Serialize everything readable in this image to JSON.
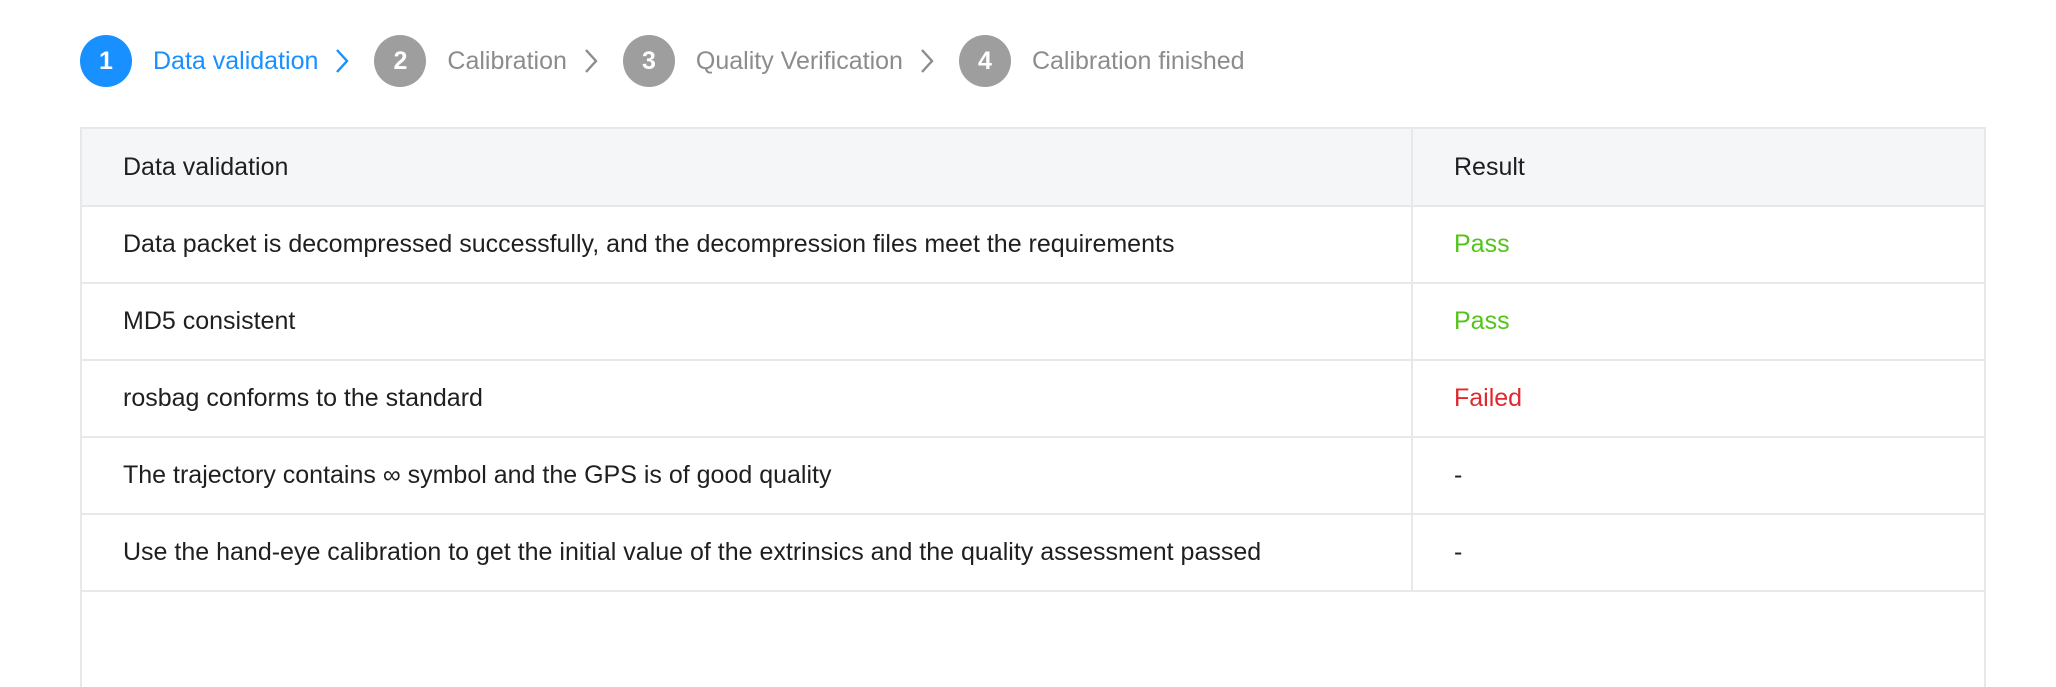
{
  "steps": [
    {
      "number": "1",
      "label": "Data validation",
      "state": "active"
    },
    {
      "number": "2",
      "label": "Calibration",
      "state": "inactive"
    },
    {
      "number": "3",
      "label": "Quality Verification",
      "state": "inactive"
    },
    {
      "number": "4",
      "label": "Calibration finished",
      "state": "inactive"
    }
  ],
  "table": {
    "headers": {
      "check": "Data validation",
      "result": "Result"
    },
    "rows": [
      {
        "check": "Data packet is decompressed successfully, and the decompression files meet the requirements",
        "result": "Pass",
        "status": "pass"
      },
      {
        "check": "MD5 consistent",
        "result": "Pass",
        "status": "pass"
      },
      {
        "check": "rosbag conforms to the standard",
        "result": "Failed",
        "status": "fail"
      },
      {
        "check": "The trajectory contains ∞ symbol and the GPS is of good quality",
        "result": "-",
        "status": "none"
      },
      {
        "check": "Use the hand-eye calibration to get the initial value of the extrinsics and the quality assessment passed",
        "result": "-",
        "status": "none"
      }
    ]
  },
  "colors": {
    "active": "#1890ff",
    "inactive": "#9e9e9e",
    "pass": "#52c41a",
    "fail": "#e0282e"
  },
  "icons": {
    "separator": "chevron-right-icon"
  }
}
